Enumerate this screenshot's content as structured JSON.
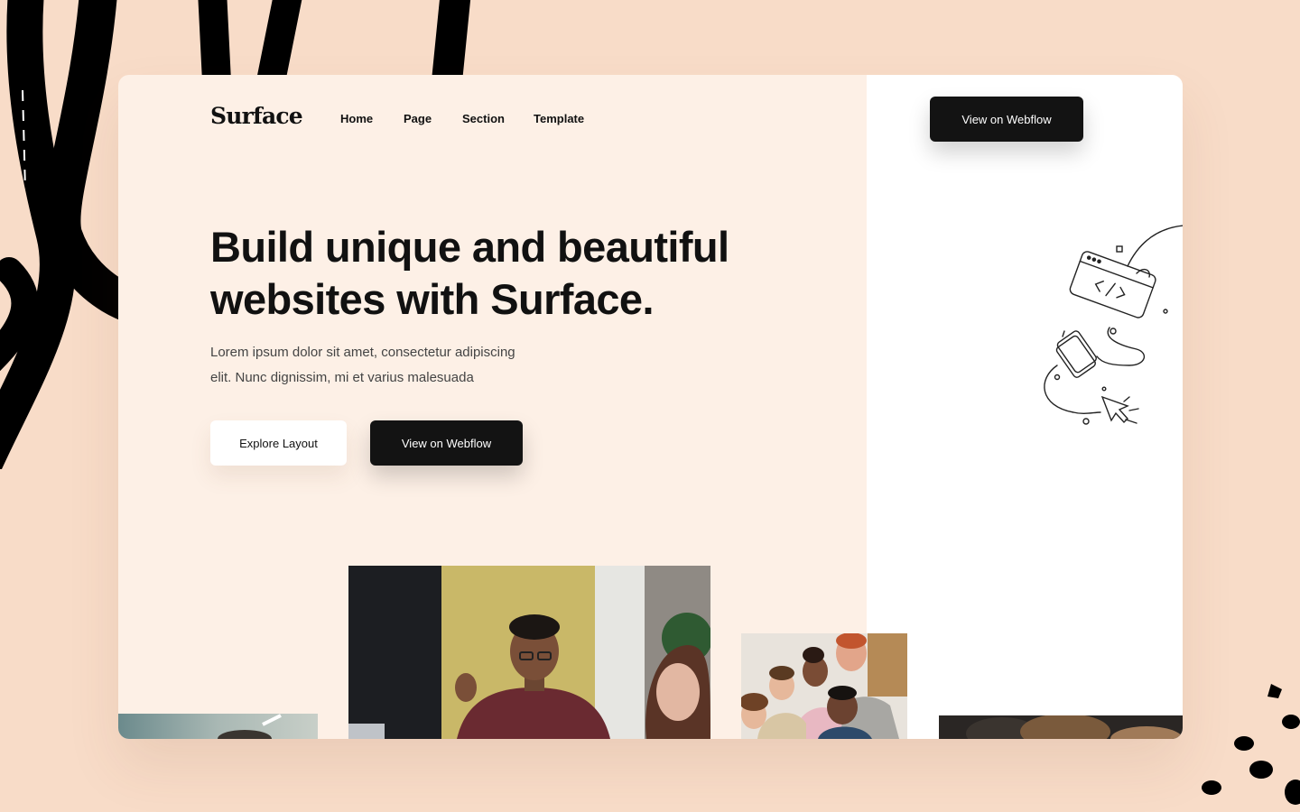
{
  "nav": {
    "logo": "Surface",
    "items": [
      {
        "label": "Home"
      },
      {
        "label": "Page"
      },
      {
        "label": "Section"
      },
      {
        "label": "Template"
      }
    ],
    "cta_label": "View on Webflow"
  },
  "hero": {
    "headline_line1": "Build unique and beautiful",
    "headline_line2": "websites with Surface.",
    "subtext_line1": "Lorem ipsum dolor sit amet, consectetur adipiscing",
    "subtext_line2": "elit. Nunc dignissim, mi et varius malesuada",
    "primary_button": "Explore Layout",
    "secondary_button": "View on Webflow"
  },
  "colors": {
    "background": "#f8dcc8",
    "card_left": "#fdf0e6",
    "card_right": "#ffffff",
    "button_dark": "#131313",
    "text": "#111111"
  },
  "icons": [
    "webflow-doodle-illustration",
    "brush-stroke-decoration",
    "ink-dots-decoration"
  ]
}
